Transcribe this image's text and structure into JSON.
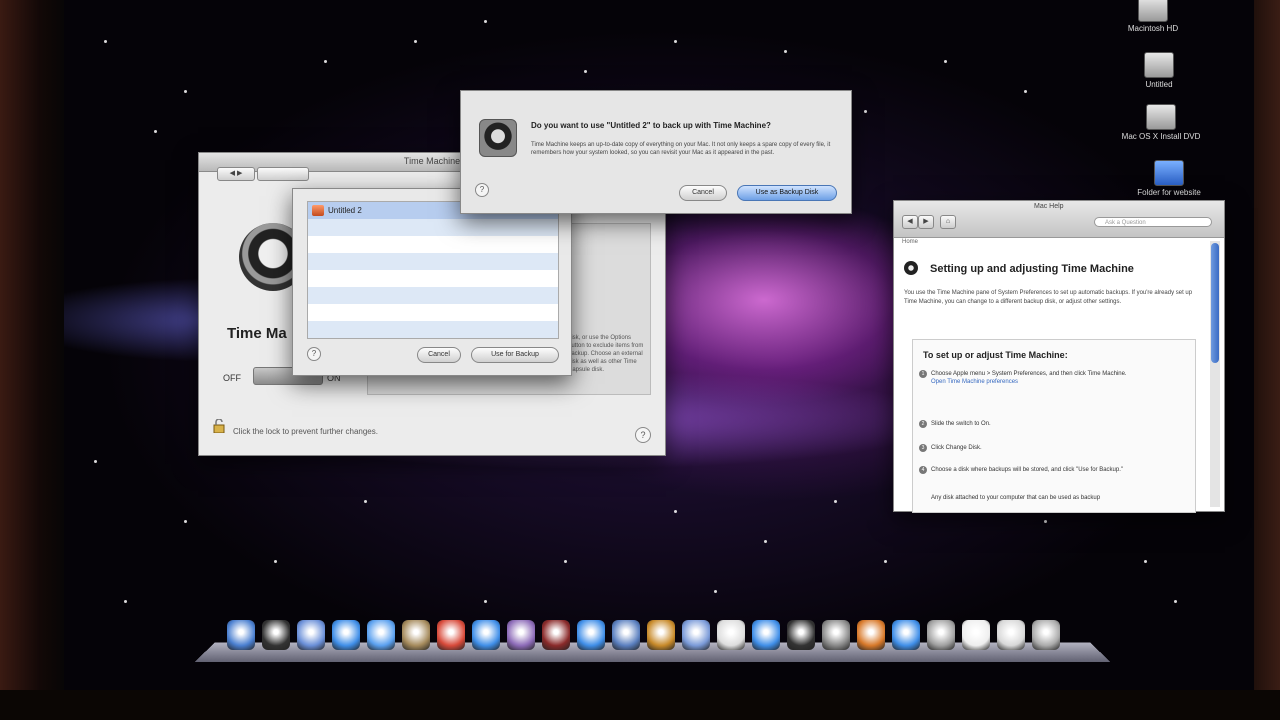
{
  "desktop": {
    "icons": [
      {
        "label": "Macintosh HD",
        "type": "drive"
      },
      {
        "label": "Untitled",
        "type": "drive"
      },
      {
        "label": "Mac OS X Install DVD",
        "type": "drive"
      },
      {
        "label": "Folder for website",
        "type": "folder"
      }
    ]
  },
  "time_machine": {
    "window_title": "Time Machine",
    "title": "Time Ma",
    "off_label": "OFF",
    "on_label": "ON",
    "panel_text": "disk, or use the Options button to exclude items from backup. Choose an external disk as well as other Time Capsule disk.",
    "lock_text": "Click the lock to prevent further changes.",
    "help": "?"
  },
  "disk_sheet": {
    "disks": [
      "Untitled 2",
      "",
      "",
      "",
      "",
      "",
      "",
      ""
    ],
    "cancel_label": "Cancel",
    "use_label": "Use for Backup",
    "help": "?"
  },
  "confirm_dialog": {
    "question": "Do you want to use \"Untitled 2\" to back up with Time Machine?",
    "detail": "Time Machine keeps an up-to-date copy of everything on your Mac. It not only keeps a spare copy of every file, it remembers how your system looked, so you can revisit your Mac as it appeared in the past.",
    "cancel_label": "Cancel",
    "confirm_label": "Use as Backup Disk",
    "help": "?"
  },
  "help_viewer": {
    "window_title": "Mac Help",
    "back": "◀",
    "forward": "▶",
    "home": "⌂",
    "search_placeholder": "Ask a Question",
    "breadcrumb": "Home",
    "heading": "Setting up and adjusting Time Machine",
    "intro": "You use the Time Machine pane of System Preferences to set up automatic backups. If you're already set up Time Machine, you can change to a different backup disk, or adjust other settings.",
    "steps_heading": "To set up or adjust Time Machine:",
    "steps": [
      {
        "num": "1",
        "text": "Choose Apple menu > System Preferences, and then click Time Machine.",
        "link": "Open Time Machine preferences"
      },
      {
        "num": "2",
        "text": "Slide the switch to On.",
        "link": ""
      },
      {
        "num": "3",
        "text": "Click Change Disk.",
        "link": ""
      },
      {
        "num": "4",
        "text": "Choose a disk where backups will be stored, and click \"Use for Backup.\"",
        "link": ""
      },
      {
        "num": "",
        "text": "Any disk attached to your computer that can be used as backup",
        "link": ""
      }
    ]
  },
  "dock": {
    "items": [
      "Finder",
      "Dashboard",
      "Mail",
      "Safari",
      "iChat",
      "Address Book",
      "iCal",
      "Preview",
      "iTunes",
      "Photo Booth",
      "Time Machine",
      "Spaces",
      "Garage Band",
      "iPhoto",
      "Calendar",
      "Safari",
      "Terminal",
      "System Preferences",
      "Firefox",
      "Network",
      "Utilities",
      "Documents",
      "Downloads",
      "Trash"
    ],
    "colors": [
      "#4a7fd0",
      "#333333",
      "#6a8fd8",
      "#3f8ee8",
      "#5aa0ef",
      "#a58a5c",
      "#d84a3a",
      "#3f8ee8",
      "#8d6bb8",
      "#8a2a2a",
      "#3f8ee8",
      "#5a7fbf",
      "#c88a2a",
      "#7a9ad8",
      "#dddddd",
      "#3f8ee8",
      "#333333",
      "#888888",
      "#d8792a",
      "#3f8ee8",
      "#a0a0a0",
      "#eeeeee",
      "#d8d8d8",
      "#aaaaaa"
    ]
  }
}
